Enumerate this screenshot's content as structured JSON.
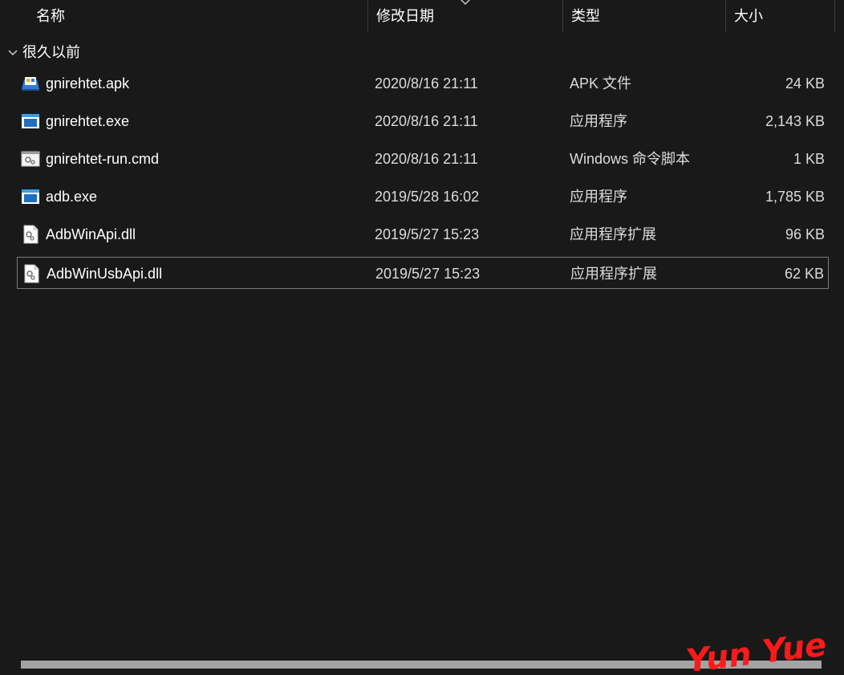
{
  "columns": {
    "name": "名称",
    "date": "修改日期",
    "type": "类型",
    "size": "大小"
  },
  "sort_indicator_icon": "chevron-down-icon",
  "group": {
    "label": "很久以前",
    "icon": "chevron-down-icon"
  },
  "files": [
    {
      "name": "gnirehtet.apk",
      "date": "2020/8/16 21:11",
      "type": "APK 文件",
      "size": "24 KB",
      "icon": "apk-file-icon"
    },
    {
      "name": "gnirehtet.exe",
      "date": "2020/8/16 21:11",
      "type": "应用程序",
      "size": "2,143 KB",
      "icon": "exe-file-icon"
    },
    {
      "name": "gnirehtet-run.cmd",
      "date": "2020/8/16 21:11",
      "type": "Windows 命令脚本",
      "size": "1 KB",
      "icon": "cmd-file-icon"
    },
    {
      "name": "adb.exe",
      "date": "2019/5/28 16:02",
      "type": "应用程序",
      "size": "1,785 KB",
      "icon": "exe-file-icon"
    },
    {
      "name": "AdbWinApi.dll",
      "date": "2019/5/27 15:23",
      "type": "应用程序扩展",
      "size": "96 KB",
      "icon": "dll-file-icon"
    },
    {
      "name": "AdbWinUsbApi.dll",
      "date": "2019/5/27 15:23",
      "type": "应用程序扩展",
      "size": "62 KB",
      "icon": "dll-file-icon",
      "selected": true
    }
  ],
  "watermark": "Yun Yue",
  "colors": {
    "background": "#191919",
    "selection_border": "#7a7a7a",
    "scrollbar": "#a3a3a3",
    "watermark": "#ff1a1a"
  }
}
